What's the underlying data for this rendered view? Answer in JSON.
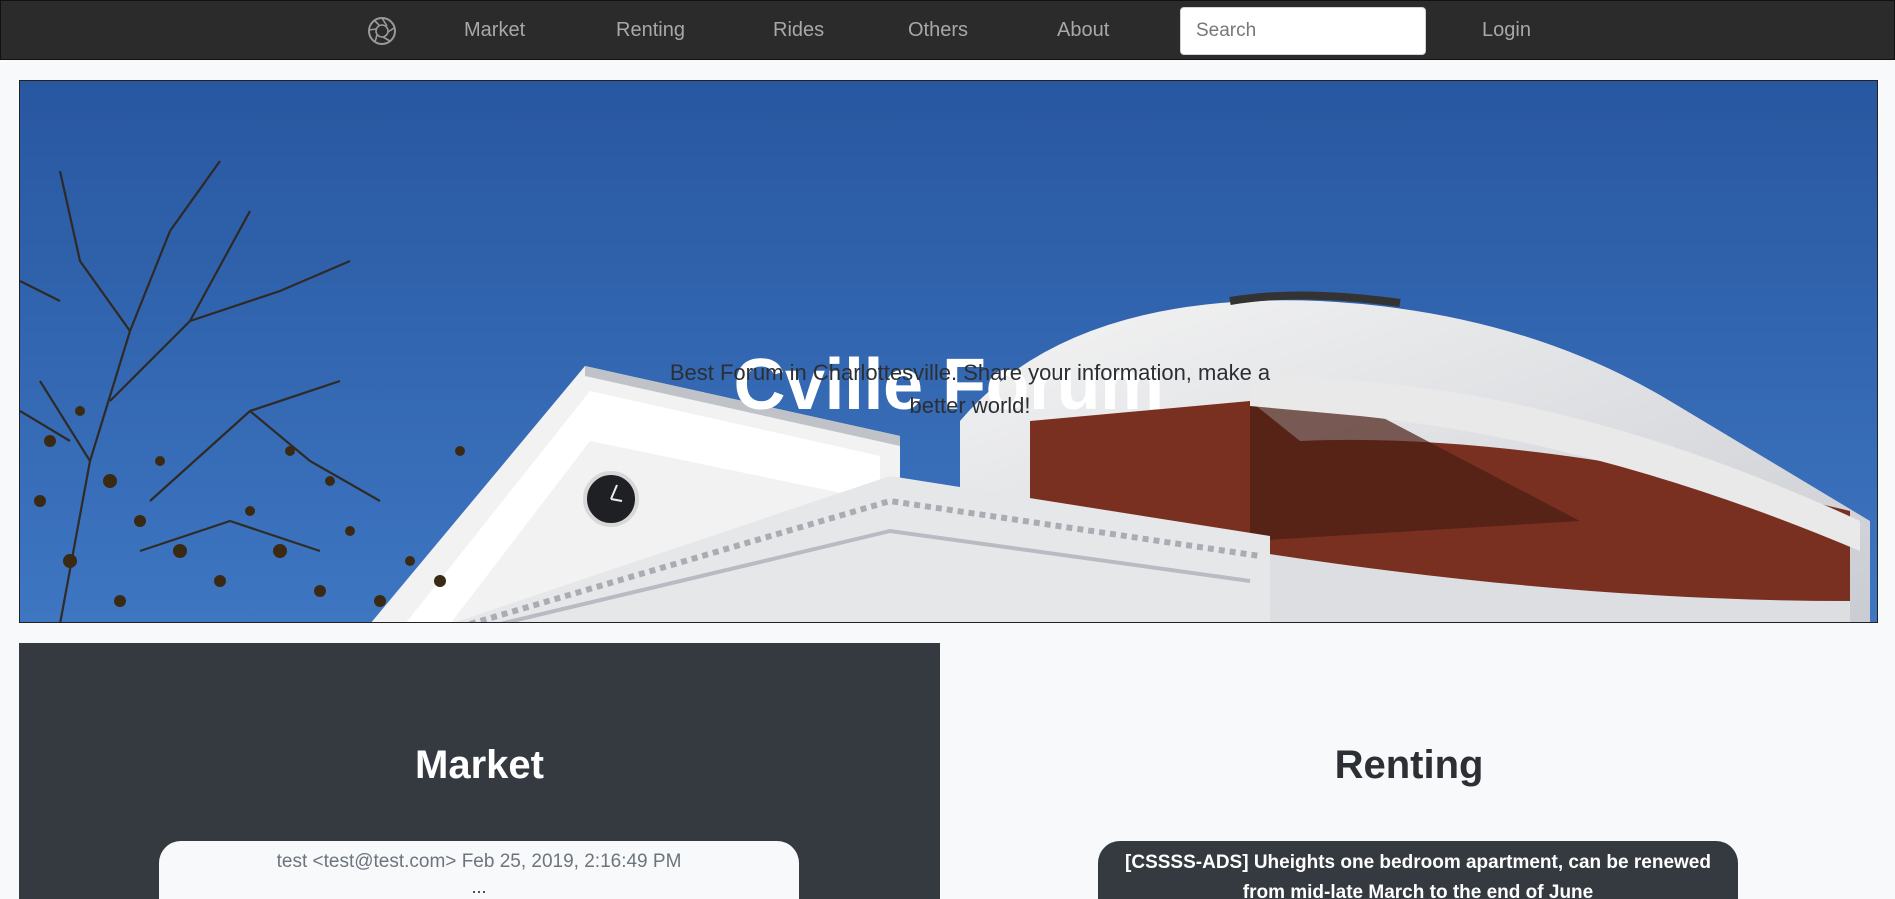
{
  "nav": {
    "logo_icon": "aperture-icon",
    "links": [
      "Market",
      "Renting",
      "Rides",
      "Others",
      "About"
    ],
    "search_placeholder": "Search",
    "login": "Login"
  },
  "hero": {
    "title": "Cville Forum",
    "subtitle": "Best Forum in Charlottesville. Share your information, make a better world!"
  },
  "market": {
    "title": "Market",
    "posts": [
      {
        "author": "test <test@test.com>",
        "date": "Feb 25, 2019, 2:16:49 PM",
        "body": "..."
      }
    ]
  },
  "renting": {
    "title": "Renting",
    "posts": [
      {
        "title": "[CSSSS-ADS] Uheights one bedroom apartment, can be renewed from mid-late March to the end of June"
      }
    ]
  },
  "colors": {
    "navbar": "#2b2b2b",
    "dark_section": "#343a40",
    "light_bg": "#f8f9fa",
    "sky": "#2f63a8"
  }
}
